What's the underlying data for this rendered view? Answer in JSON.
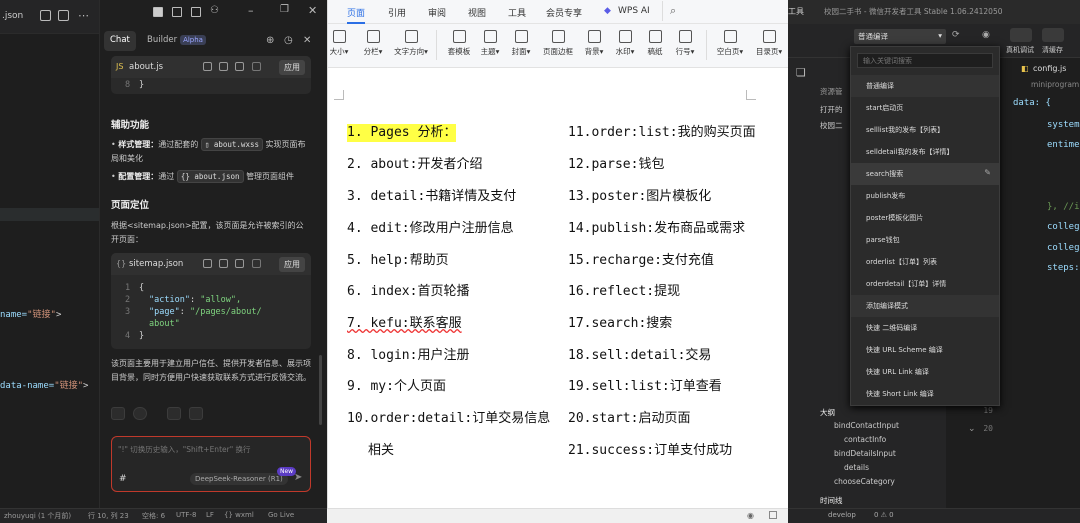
{
  "left_editor": {
    "tab_name": ".json",
    "code_lines": [
      {
        "prefix": "name=",
        "string": "\"链接\"",
        "suffix": ">"
      },
      {
        "prefix": "data-name=",
        "string": "\"链接\"",
        "suffix": ">"
      }
    ]
  },
  "chat": {
    "tabs": {
      "chat": "Chat",
      "builder": "Builder",
      "alpha_badge": "Alpha"
    },
    "card1": {
      "icon": "JS",
      "filename": "about.js",
      "apply": "应用",
      "line_no": "8",
      "code": "}"
    },
    "section_aux": {
      "title": "辅助功能",
      "bullets": [
        {
          "label": "样式管理：",
          "pre": "通过配套的",
          "chip": "about.wxss",
          "post": "实现页面布局和美化"
        },
        {
          "label": "配置管理：",
          "pre": "通过",
          "chip": "about.json",
          "post": "管理页面组件"
        }
      ]
    },
    "section_pos": {
      "title": "页面定位",
      "text": "根据<sitemap.json>配置，该页面是允许被索引的公开页面："
    },
    "card2": {
      "icon": "{}",
      "filename": "sitemap.json",
      "apply": "应用",
      "lines": [
        {
          "n": "1",
          "code": "{"
        },
        {
          "n": "2",
          "key": "\"action\"",
          "value": "\"allow\","
        },
        {
          "n": "3",
          "key": "\"page\"",
          "value": "\"/pages/about/"
        },
        {
          "n": "",
          "key": "",
          "value": "about\""
        },
        {
          "n": "4",
          "code": "}"
        }
      ]
    },
    "summary": "该页面主要用于建立用户信任、提供开发者信息、展示项目背景，同时方便用户快速获取联系方式进行反馈交流。",
    "input": {
      "placeholder": "\"!\" 切换历史输入，\"Shift+Enter\" 换行",
      "hash": "#",
      "model": "DeepSeek-Reasoner (R1)",
      "new_badge": "New"
    }
  },
  "doc": {
    "menu": [
      "页面",
      "引用",
      "审阅",
      "视图",
      "工具",
      "会员专享",
      "WPS AI"
    ],
    "active_menu": "页面",
    "ribbon": [
      {
        "label": "大小▾",
        "icon": "page-size-icon"
      },
      {
        "label": "分栏▾",
        "icon": "columns-icon"
      },
      {
        "label": "文字方向▾",
        "icon": "text-direction-icon"
      },
      {
        "label": "套模板",
        "icon": "template-icon"
      },
      {
        "label": "主题▾",
        "icon": "theme-icon"
      },
      {
        "label": "封面▾",
        "icon": "cover-icon"
      },
      {
        "label": "页面边框",
        "icon": "page-border-icon"
      },
      {
        "label": "背景▾",
        "icon": "background-icon"
      },
      {
        "label": "水印▾",
        "icon": "watermark-icon"
      },
      {
        "label": "稿纸",
        "icon": "draft-paper-icon"
      },
      {
        "label": "行号▾",
        "icon": "line-number-icon"
      },
      {
        "label": "空白页▾",
        "icon": "blank-page-icon"
      },
      {
        "label": "目录页▾",
        "icon": "toc-page-icon"
      }
    ],
    "list_left": [
      "1. Pages 分析：",
      "2. about:开发者介绍",
      "3. detail:书籍详情及支付",
      "4. edit:修改用户注册信息",
      "5. help:帮助页",
      "6. index:首页轮播",
      "7. kefu:联系客服",
      "8. login:用户注册",
      "9. my:个人页面",
      "10.order:detail:订单交易信息",
      "相关"
    ],
    "list_right": [
      "11.order:list:我的购买页面",
      "12.parse:钱包",
      "13.poster:图片模板化",
      "14.publish:发布商品或需求",
      "15.recharge:支付充值",
      "16.reflect:提现",
      "17.search:搜索",
      "18.sell:detail:交易",
      "19.sell:list:订单查看",
      "20.start:启动页面",
      "21.success:订单支付成功"
    ]
  },
  "ide": {
    "title": "校园二手书 - 微信开发者工具 Stable 1.06.2412050",
    "title_prefix": "工具",
    "mode": "普通编译",
    "toolbar_labels": [
      "真机调试",
      "清缓存"
    ],
    "tab_file": "config.js",
    "breadcrumb": "miniprogram",
    "dropdown": {
      "search_placeholder": "输入关键词搜索",
      "items": [
        "普通编译",
        "start启动页",
        "selllist我的发布【列表】",
        "selldetail我的发布【详情】",
        "search搜索",
        "publish发布",
        "poster模板化图片",
        "parse钱包",
        "orderlist【订单】列表",
        "orderdetail【订单】详情",
        "添加编译模式",
        "快速 二维码编译",
        "快速 URL Scheme 编译",
        "快速 URL Link 编译",
        "快速 Short Link 编译"
      ]
    },
    "tree": [
      "资源管",
      "打开的",
      "校园二",
      "大纲",
      "bindContactInput",
      "contactInfo",
      "bindDetailsInput",
      "details",
      "chooseCategory",
      "时间线"
    ],
    "code": [
      "data: {",
      "system",
      "entime",
      "}, //i",
      "colleg",
      "colleg",
      "steps:"
    ],
    "gutter": [
      "19",
      "20"
    ]
  },
  "status": {
    "left": [
      "zhouyuqi (1 个月前)",
      "行 10, 列 23",
      "空格: 6",
      "UTF-8",
      "LF",
      "{} wxml",
      "Go Live"
    ],
    "right": [
      "develop",
      "0 ⚠ 0"
    ]
  }
}
